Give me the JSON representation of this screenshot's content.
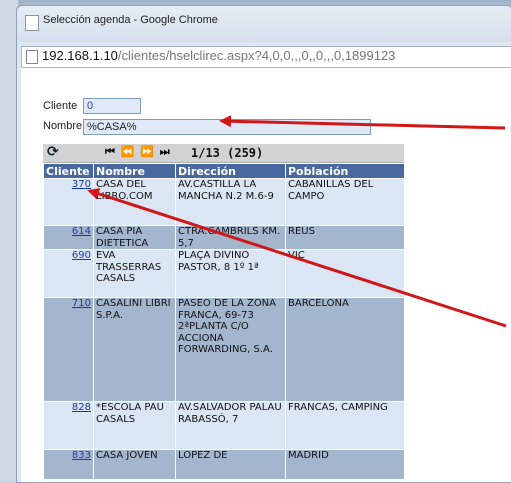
{
  "window": {
    "title": "Selección agenda - Google Chrome",
    "url_host": "192.168.1.10",
    "url_path": "/clientes/hselclirec.aspx?4,0,0,,,0,,0,,,0,1899123"
  },
  "form": {
    "cliente_label": "Cliente",
    "cliente_value": "0",
    "nombre_label": "Nombre",
    "nombre_value": "%CASA%"
  },
  "pager": {
    "refresh_icon": "refresh-icon",
    "nav_glyphs": "⏮ ⏪ ⏩ ⏭",
    "page_info": "1/13 (259)"
  },
  "table": {
    "headers": [
      "Cliente",
      "Nombre",
      "Dirección",
      "Población"
    ],
    "rows": [
      {
        "cliente": "370",
        "nombre": "CASA DEL LIBRO.COM",
        "direccion": "AV.CASTILLA LA MANCHA N.2 M.6-9",
        "poblacion": "CABANILLAS DEL CAMPO"
      },
      {
        "cliente": "614",
        "nombre": "CASA PIA DIETETICA",
        "direccion": "CTRA.CAMBRILS KM. 5,7",
        "poblacion": "REUS"
      },
      {
        "cliente": "690",
        "nombre": "EVA TRASSERRAS CASALS",
        "direccion": "PLAÇA DIVINO PASTOR, 8 1º 1ª",
        "poblacion": "VIC"
      },
      {
        "cliente": "710",
        "nombre": "CASALINI LIBRI S.P.A.",
        "direccion": "PASEO DE LA ZONA FRANCA, 69-73 2ªPLANTA C/O ACCIONA FORWARDING, S.A.",
        "poblacion": "BARCELONA"
      },
      {
        "cliente": "828",
        "nombre": "*ESCOLA PAU CASALS",
        "direccion": "AV.SALVADOR PALAU RABASSÓ, 7",
        "poblacion": "FRANCAS, CAMPING"
      },
      {
        "cliente": "833",
        "nombre": "CASA JOVEN",
        "direccion": "LOPEZ DE",
        "poblacion": "MADRID"
      }
    ]
  },
  "colors": {
    "header_bg": "#4a68a0",
    "row_light": "#dbe6f4",
    "row_dark": "#a4b6ce",
    "arrow": "#d01818"
  }
}
